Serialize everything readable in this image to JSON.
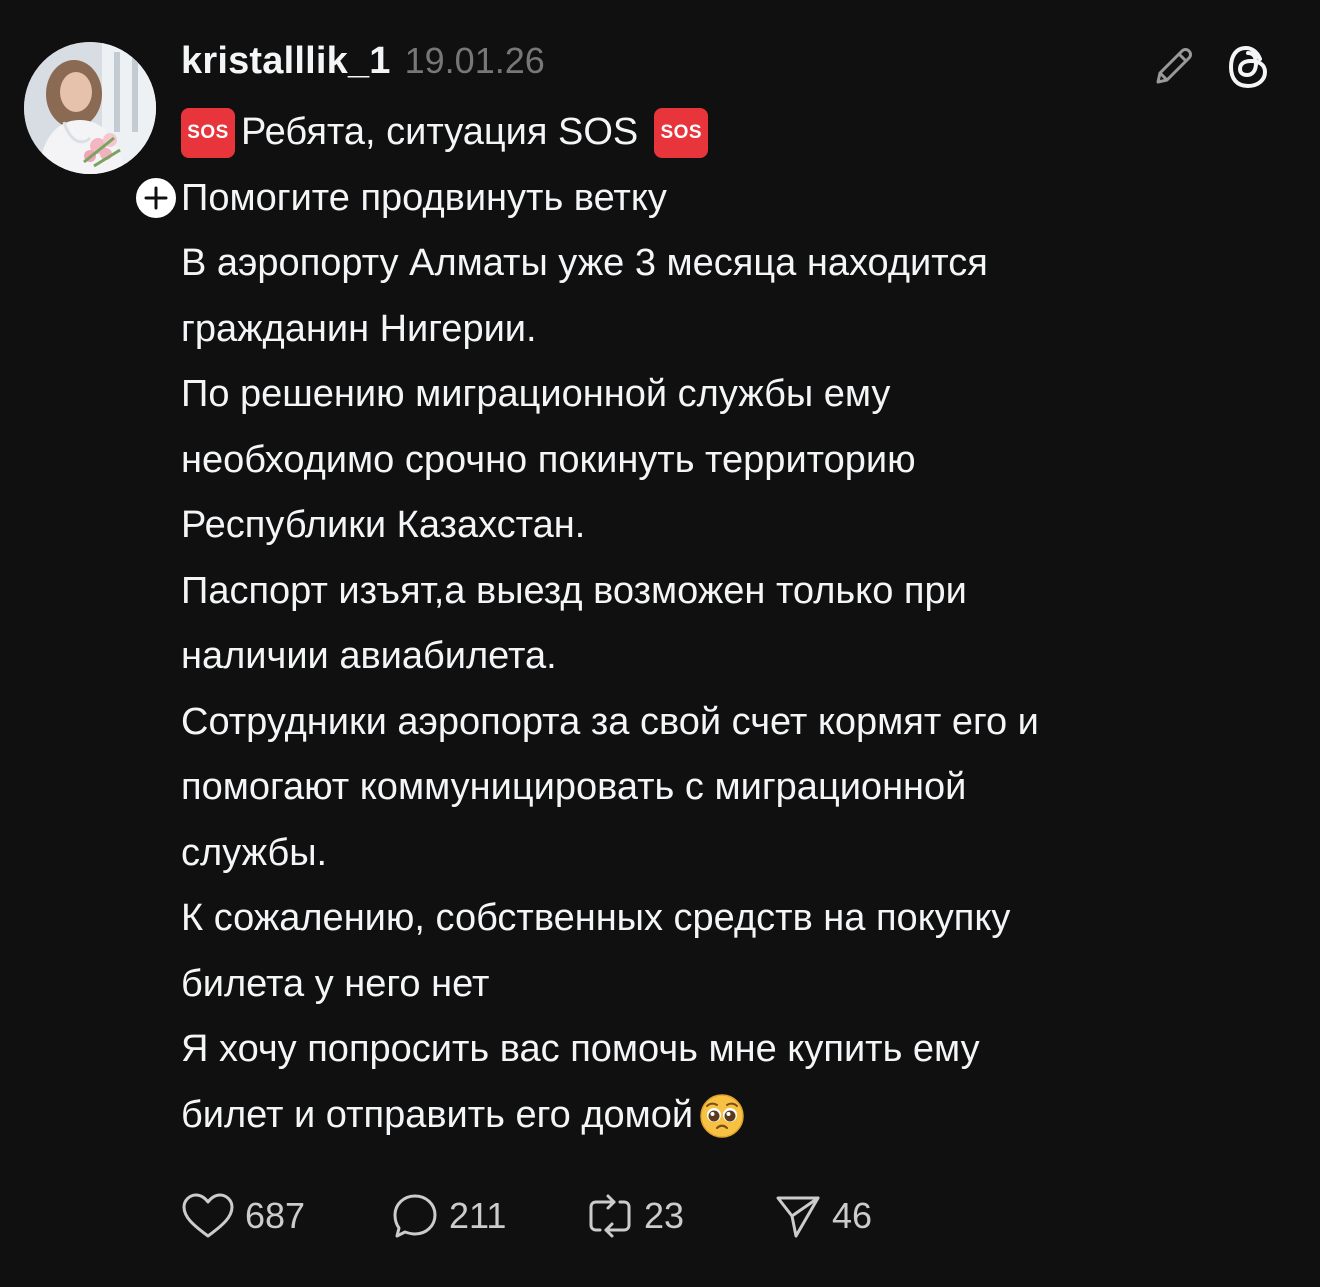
{
  "post": {
    "username": "kristalllik_1",
    "timestamp": "19.01.26",
    "sos_badge": "SOS",
    "lines": [
      "Ребята, ситуация SOS",
      "Помогите продвинуть ветку",
      "В аэропорту Алматы уже 3 месяца находится",
      "гражданин Нигерии.",
      "По решению миграционной службы ему",
      "необходимо срочно покинуть территорию",
      "Республики Казахстан.",
      "Паспорт изъят,а выезд возможен только при",
      "наличии авиабилета.",
      "Сотрудники аэропорта за свой счет кормят его и",
      "помогают коммуницировать с миграционной",
      "службы.",
      "К сожалению, собственных средств на покупку",
      "билета у него нет",
      "Я хочу попросить вас помочь мне купить ему",
      "билет и отправить его домой"
    ],
    "end_emoji": "pleading-face-emoji"
  },
  "actions": {
    "likes": "687",
    "replies": "211",
    "reposts": "23",
    "shares": "46"
  },
  "icons": {
    "edit": "pencil-icon",
    "app": "threads-logo-icon",
    "like": "heart-icon",
    "reply": "comment-bubble-icon",
    "repost": "repost-icon",
    "share": "send-icon",
    "follow": "plus-icon"
  },
  "colors": {
    "background": "#101010",
    "text": "#f3f5f7",
    "muted": "#777777",
    "sos_red": "#e8343b"
  }
}
